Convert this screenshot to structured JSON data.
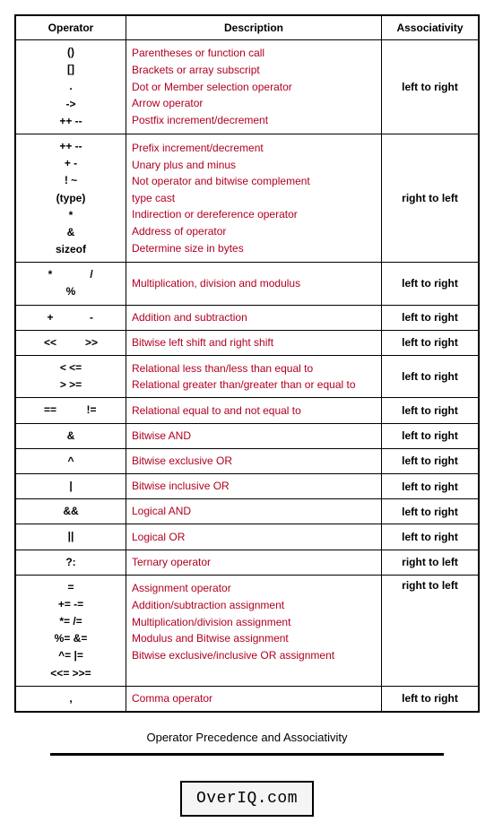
{
  "headers": {
    "op": "Operator",
    "desc": "Description",
    "assoc": "Associativity"
  },
  "rows": [
    {
      "ops": [
        "()",
        "[]",
        ".",
        "->",
        "++ --"
      ],
      "desc": [
        "Parentheses or function call",
        "Brackets or array subscript",
        "Dot or Member selection operator",
        "Arrow operator",
        "Postfix increment/decrement"
      ],
      "assoc": "left to right"
    },
    {
      "ops": [
        "++ --",
        "+ -",
        "! ~",
        "(type)",
        "*",
        "&",
        "sizeof"
      ],
      "desc": [
        "Prefix increment/decrement",
        "Unary plus and minus",
        "Not operator and bitwise complement",
        "type cast",
        "Indirection or dereference operator",
        "Address of operator",
        "Determine size in bytes"
      ],
      "assoc": "right to left"
    },
    {
      "ops_inline": [
        "*",
        "/",
        "%"
      ],
      "desc": [
        "Multiplication, division and modulus"
      ],
      "assoc": "left to right"
    },
    {
      "ops_inline": [
        "+",
        "-"
      ],
      "desc": [
        "Addition and subtraction"
      ],
      "assoc": "left to right"
    },
    {
      "ops_inline": [
        "<<",
        ">>"
      ],
      "desc": [
        "Bitwise left shift and right shift"
      ],
      "assoc": "left to right"
    },
    {
      "ops": [
        "<  <=",
        ">  >="
      ],
      "desc": [
        "Relational less than/less than equal to",
        "Relational greater than/greater than or equal to"
      ],
      "assoc": "left to right"
    },
    {
      "ops_inline": [
        "==",
        "!="
      ],
      "desc": [
        "Relational equal to and not equal to"
      ],
      "assoc": "left to right"
    },
    {
      "ops_inline": [
        "&"
      ],
      "desc": [
        "Bitwise AND"
      ],
      "assoc": "left to right"
    },
    {
      "ops_inline": [
        "^"
      ],
      "desc": [
        "Bitwise exclusive OR"
      ],
      "assoc": "left to right"
    },
    {
      "ops_inline": [
        "|"
      ],
      "desc": [
        "Bitwise inclusive OR"
      ],
      "assoc": "left to right"
    },
    {
      "ops_inline": [
        "&&"
      ],
      "desc": [
        "Logical AND"
      ],
      "assoc": "left to right"
    },
    {
      "ops_inline": [
        "||"
      ],
      "desc": [
        "Logical OR"
      ],
      "assoc": "left to right"
    },
    {
      "ops_inline": [
        "?:"
      ],
      "desc": [
        "Ternary operator"
      ],
      "assoc": "right to left"
    },
    {
      "ops": [
        "=",
        "+=   -=",
        "*=   /=",
        "%=   &=",
        "^=   |=",
        "<<=  >>="
      ],
      "desc": [
        "Assignment operator",
        "Addition/subtraction assignment",
        "Multiplication/division assignment",
        "Modulus and Bitwise assignment",
        "Bitwise exclusive/inclusive OR assignment",
        ""
      ],
      "assoc": "right to left",
      "assoc_valign": "top"
    },
    {
      "ops_inline": [
        ","
      ],
      "desc": [
        "Comma operator"
      ],
      "assoc": "left to right"
    }
  ],
  "caption": "Operator Precedence and Associativity",
  "watermark": "OverIQ.com"
}
